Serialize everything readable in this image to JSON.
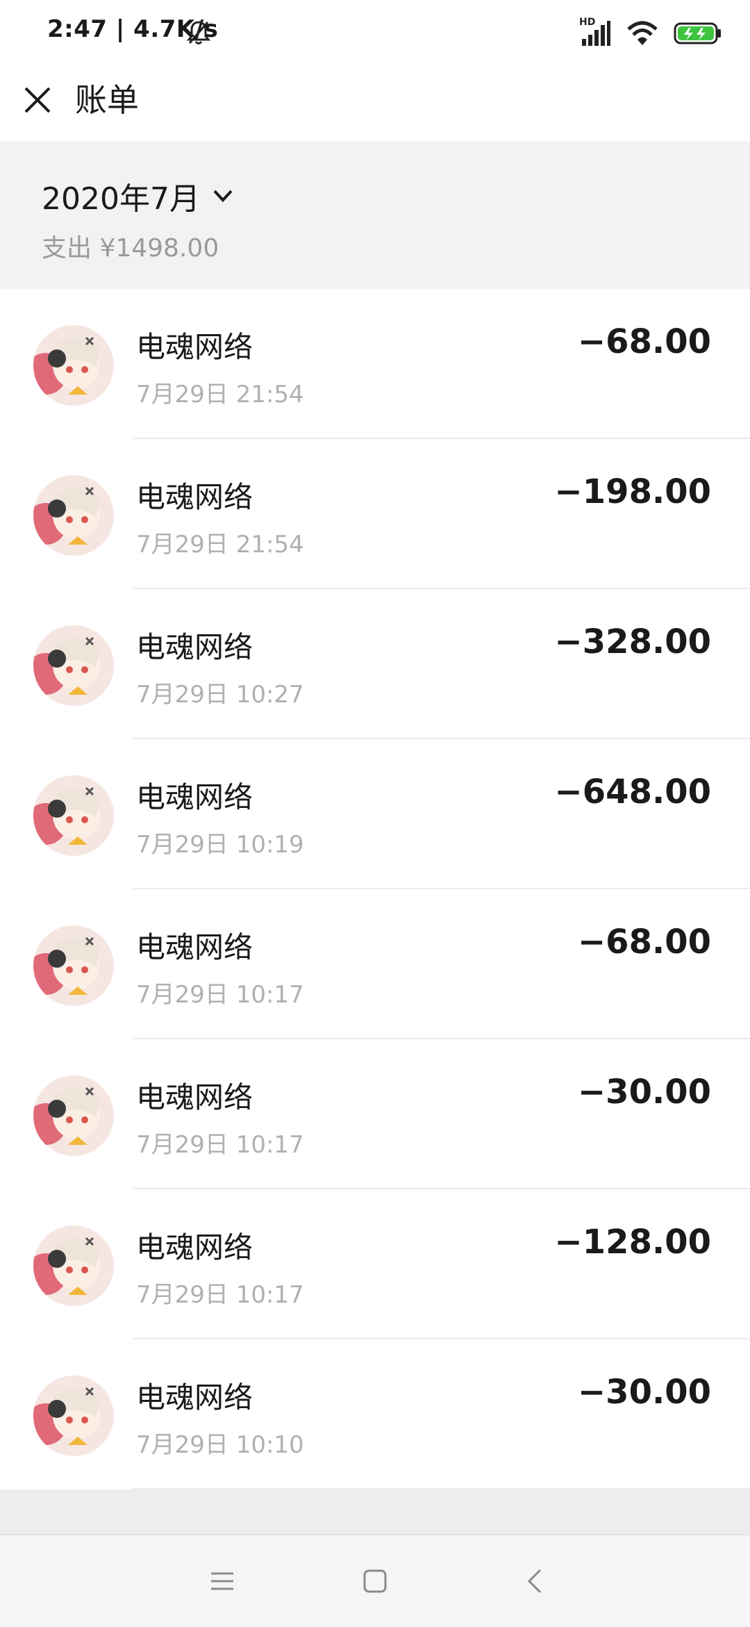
{
  "status_bar": {
    "time": "2:47 | 4.7K/s",
    "network_badge": "HD",
    "icons": [
      "bell-off-icon",
      "signal-icon",
      "wifi-icon",
      "battery-charging-icon"
    ]
  },
  "header": {
    "title": "账单",
    "close_icon": "close-icon"
  },
  "summary": {
    "month": "2020年7月",
    "expense": "支出 ¥1498.00"
  },
  "transactions": [
    {
      "merchant": "电魂网络",
      "datetime": "7月29日 21:54",
      "amount": "−68.00"
    },
    {
      "merchant": "电魂网络",
      "datetime": "7月29日 21:54",
      "amount": "−198.00"
    },
    {
      "merchant": "电魂网络",
      "datetime": "7月29日 10:27",
      "amount": "−328.00"
    },
    {
      "merchant": "电魂网络",
      "datetime": "7月29日 10:19",
      "amount": "−648.00"
    },
    {
      "merchant": "电魂网络",
      "datetime": "7月29日 10:17",
      "amount": "−68.00"
    },
    {
      "merchant": "电魂网络",
      "datetime": "7月29日 10:17",
      "amount": "−30.00"
    },
    {
      "merchant": "电魂网络",
      "datetime": "7月29日 10:17",
      "amount": "−128.00"
    },
    {
      "merchant": "电魂网络",
      "datetime": "7月29日 10:10",
      "amount": "−30.00"
    }
  ],
  "nav_bar": {
    "icons": [
      "menu-icon",
      "home-icon",
      "back-icon"
    ]
  },
  "colors": {
    "accent_battery": "#3ec43e",
    "page_bg": "#ededed",
    "muted_text": "#b0b0b0"
  }
}
